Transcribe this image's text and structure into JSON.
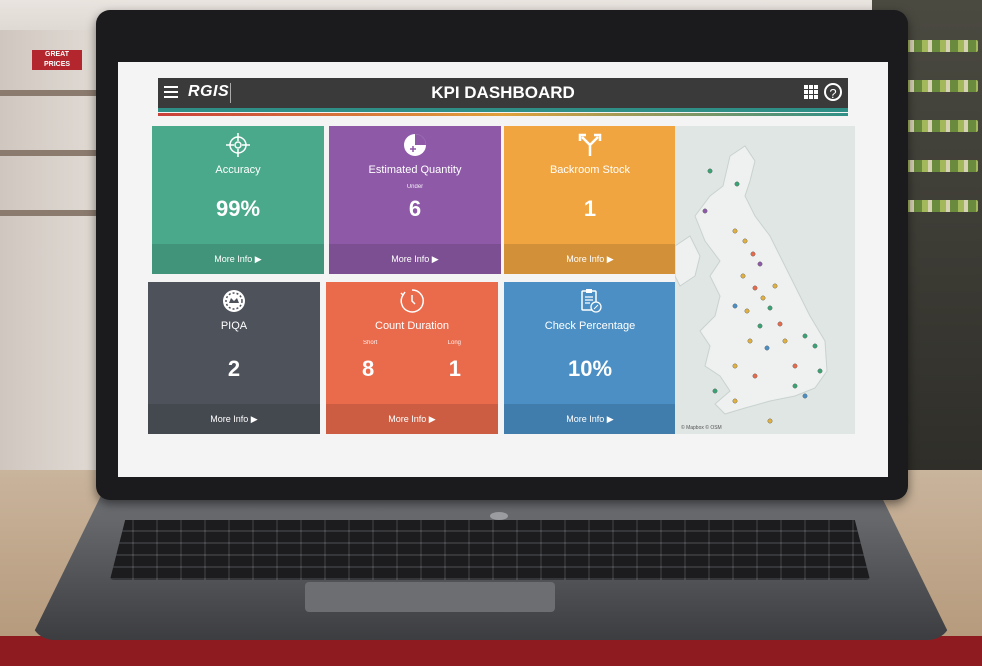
{
  "scene": {
    "store_sign": "GREAT PRICES"
  },
  "header": {
    "brand": "RGIS",
    "title": "KPI DASHBOARD"
  },
  "tiles": [
    {
      "name": "accuracy",
      "label": "Accuracy",
      "value": "99%",
      "footer": "More Info ▶",
      "color": "#4aa98a",
      "icon": "crosshair-icon"
    },
    {
      "name": "estimated-quantity",
      "label": "Estimated Quantity",
      "sub": "Under",
      "value": "6",
      "footer": "More Info ▶",
      "color": "#8e5aa8",
      "icon": "pie-icon"
    },
    {
      "name": "backroom-stock",
      "label": "Backroom Stock",
      "value": "1",
      "footer": "More Info ▶",
      "color": "#f0a540",
      "icon": "split-arrow-icon"
    },
    {
      "name": "piqa",
      "label": "PIQA",
      "value": "2",
      "footer": "More Info ▶",
      "color": "#4e525a",
      "icon": "badge-icon"
    },
    {
      "name": "count-duration",
      "label": "Count Duration",
      "sub_left": "Short",
      "sub_right": "Long",
      "value_left": "8",
      "value_right": "1",
      "footer": "More Info ▶",
      "color": "#ea6a4c",
      "icon": "clock-icon"
    },
    {
      "name": "check-percentage",
      "label": "Check Percentage",
      "value": "10%",
      "footer": "More Info ▶",
      "color": "#4b8fc4",
      "icon": "clipboard-percent-icon"
    }
  ],
  "map": {
    "attribution": "© Mapbox © OSM"
  }
}
